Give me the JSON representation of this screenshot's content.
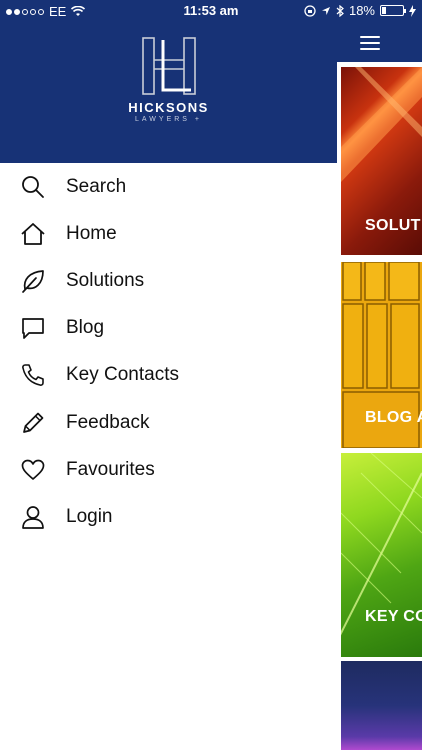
{
  "status_bar": {
    "carrier": "EE",
    "time": "11:53 am",
    "battery": "18%"
  },
  "brand": {
    "name": "HICKSONS",
    "subtitle": "LAWYERS +",
    "header_color": "#173276"
  },
  "menu": {
    "items": [
      {
        "label": "Search",
        "icon": "search-icon"
      },
      {
        "label": "Home",
        "icon": "home-icon"
      },
      {
        "label": "Solutions",
        "icon": "leaf-icon"
      },
      {
        "label": "Blog",
        "icon": "speech-bubble-icon"
      },
      {
        "label": "Key Contacts",
        "icon": "phone-icon"
      },
      {
        "label": "Feedback",
        "icon": "pencil-icon"
      },
      {
        "label": "Favourites",
        "icon": "heart-icon"
      },
      {
        "label": "Login",
        "icon": "user-icon"
      }
    ]
  },
  "tiles": [
    {
      "label": "SOLUT"
    },
    {
      "label": "BLOG A"
    },
    {
      "label": "KEY CO"
    },
    {
      "label": ""
    }
  ]
}
